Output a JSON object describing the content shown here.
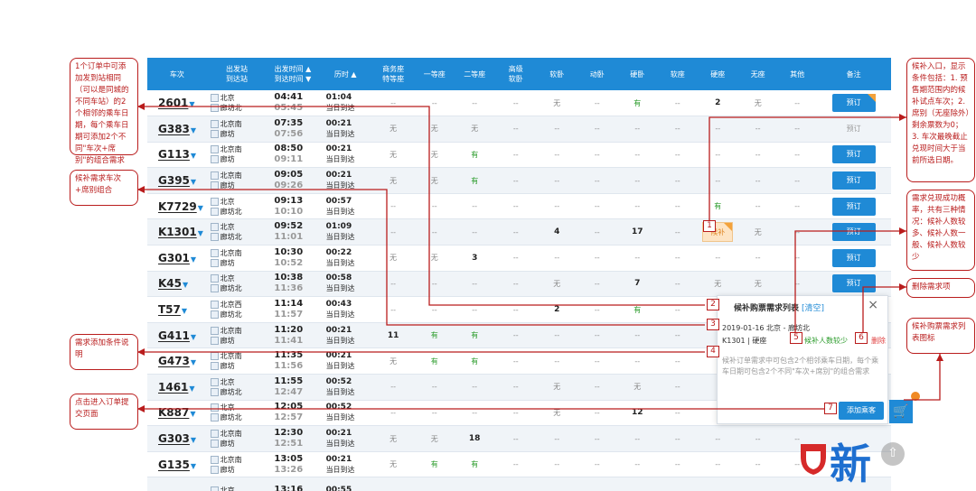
{
  "table": {
    "headers": {
      "train_no": "车次",
      "stations_dep": "出发站",
      "stations_arr": "到达站",
      "time_dep": "出发时间",
      "time_arr": "到达时间",
      "duration": "历时",
      "business_line1": "商务座",
      "business_line2": "特等座",
      "first": "一等座",
      "second": "二等座",
      "premium_line1": "高级",
      "premium_line2": "软卧",
      "soft_sleeper": "软卧",
      "moving_sleeper": "动卧",
      "hard_sleeper": "硬卧",
      "soft_seat": "软座",
      "hard_seat": "硬座",
      "no_seat": "无座",
      "other": "其他",
      "remark": "备注"
    },
    "rows": [
      {
        "train": "2601",
        "from": "北京",
        "to": "廊坊北",
        "dep": "04:41",
        "arr": "05:45",
        "dur": "01:04",
        "arrive": "当日到达",
        "seats": [
          "--",
          "--",
          "--",
          "--",
          "无",
          "--",
          "有",
          "--",
          "2",
          "无",
          "--"
        ],
        "action": "预订",
        "action_state": "enabled",
        "badge": true
      },
      {
        "train": "G383",
        "from": "北京南",
        "to": "廊坊",
        "dep": "07:35",
        "arr": "07:56",
        "dur": "00:21",
        "arrive": "当日到达",
        "seats": [
          "无",
          "无",
          "无",
          "--",
          "--",
          "--",
          "--",
          "--",
          "--",
          "--",
          "--"
        ],
        "action": "预订",
        "action_state": "disabled",
        "badge": false
      },
      {
        "train": "G113",
        "from": "北京南",
        "to": "廊坊",
        "dep": "08:50",
        "arr": "09:11",
        "dur": "00:21",
        "arrive": "当日到达",
        "seats": [
          "无",
          "无",
          "有",
          "--",
          "--",
          "--",
          "--",
          "--",
          "--",
          "--",
          "--"
        ],
        "action": "预订",
        "action_state": "enabled",
        "badge": false
      },
      {
        "train": "G395",
        "from": "北京南",
        "to": "廊坊",
        "dep": "09:05",
        "arr": "09:26",
        "dur": "00:21",
        "arrive": "当日到达",
        "seats": [
          "无",
          "无",
          "有",
          "--",
          "--",
          "--",
          "--",
          "--",
          "--",
          "--",
          "--"
        ],
        "action": "预订",
        "action_state": "enabled",
        "badge": false
      },
      {
        "train": "K7729",
        "from": "北京",
        "to": "廊坊北",
        "dep": "09:13",
        "arr": "10:10",
        "dur": "00:57",
        "arrive": "当日到达",
        "seats": [
          "--",
          "--",
          "--",
          "--",
          "--",
          "--",
          "--",
          "--",
          "有",
          "--",
          "--"
        ],
        "action": "预订",
        "action_state": "enabled",
        "badge": false
      },
      {
        "train": "K1301",
        "from": "北京",
        "to": "廊坊北",
        "dep": "09:52",
        "arr": "11:01",
        "dur": "01:09",
        "arrive": "当日到达",
        "seats": [
          "--",
          "--",
          "--",
          "--",
          "4",
          "--",
          "17",
          "--",
          "候补",
          "无",
          "--"
        ],
        "action": "预订",
        "action_state": "enabled",
        "badge": false
      },
      {
        "train": "G301",
        "from": "北京南",
        "to": "廊坊",
        "dep": "10:30",
        "arr": "10:52",
        "dur": "00:22",
        "arrive": "当日到达",
        "seats": [
          "无",
          "无",
          "3",
          "--",
          "--",
          "--",
          "--",
          "--",
          "--",
          "--",
          "--"
        ],
        "action": "预订",
        "action_state": "enabled",
        "badge": false
      },
      {
        "train": "K45",
        "from": "北京",
        "to": "廊坊北",
        "dep": "10:38",
        "arr": "11:36",
        "dur": "00:58",
        "arrive": "当日到达",
        "seats": [
          "--",
          "--",
          "--",
          "--",
          "无",
          "--",
          "7",
          "--",
          "无",
          "无",
          "--"
        ],
        "action": "预订",
        "action_state": "enabled",
        "badge": false
      },
      {
        "train": "T57",
        "from": "北京西",
        "to": "廊坊北",
        "dep": "11:14",
        "arr": "11:57",
        "dur": "00:43",
        "arrive": "当日到达",
        "seats": [
          "--",
          "--",
          "--",
          "--",
          "2",
          "--",
          "有",
          "--",
          "",
          "",
          "--"
        ],
        "action": "",
        "action_state": "hidden",
        "badge": false
      },
      {
        "train": "G411",
        "from": "北京南",
        "to": "廊坊",
        "dep": "11:20",
        "arr": "11:41",
        "dur": "00:21",
        "arrive": "当日到达",
        "seats": [
          "11",
          "有",
          "有",
          "--",
          "--",
          "--",
          "--",
          "--",
          "",
          "",
          "--"
        ],
        "action": "",
        "action_state": "hidden",
        "badge": false
      },
      {
        "train": "G473",
        "from": "北京南",
        "to": "廊坊",
        "dep": "11:35",
        "arr": "11:56",
        "dur": "00:21",
        "arrive": "当日到达",
        "seats": [
          "无",
          "有",
          "有",
          "--",
          "--",
          "--",
          "--",
          "--",
          "",
          "",
          "--"
        ],
        "action": "",
        "action_state": "hidden",
        "badge": false
      },
      {
        "train": "1461",
        "from": "北京",
        "to": "廊坊北",
        "dep": "11:55",
        "arr": "12:47",
        "dur": "00:52",
        "arrive": "当日到达",
        "seats": [
          "--",
          "--",
          "--",
          "--",
          "无",
          "--",
          "无",
          "--",
          "",
          "",
          "--"
        ],
        "action": "",
        "action_state": "hidden",
        "badge": false
      },
      {
        "train": "K887",
        "from": "北京",
        "to": "廊坊北",
        "dep": "12:05",
        "arr": "12:57",
        "dur": "00:52",
        "arrive": "当日到达",
        "seats": [
          "--",
          "--",
          "--",
          "--",
          "无",
          "--",
          "12",
          "--",
          "",
          "",
          "--"
        ],
        "action": "",
        "action_state": "hidden",
        "badge": false
      },
      {
        "train": "G303",
        "from": "北京南",
        "to": "廊坊",
        "dep": "12:30",
        "arr": "12:51",
        "dur": "00:21",
        "arrive": "当日到达",
        "seats": [
          "无",
          "无",
          "18",
          "--",
          "--",
          "--",
          "--",
          "--",
          "--",
          "--",
          "--"
        ],
        "action": "",
        "action_state": "hidden",
        "badge": false
      },
      {
        "train": "G135",
        "from": "北京南",
        "to": "廊坊",
        "dep": "13:05",
        "arr": "13:26",
        "dur": "00:21",
        "arrive": "当日到达",
        "seats": [
          "无",
          "有",
          "有",
          "--",
          "--",
          "--",
          "--",
          "--",
          "--",
          "--",
          "--"
        ],
        "action": "",
        "action_state": "hidden",
        "badge": false
      }
    ],
    "partial_row": {
      "from": "北京",
      "dep": "13:16",
      "dur": "00:55"
    }
  },
  "popup": {
    "title": "候补购票需求列表",
    "clear": "[清空]",
    "close": "×",
    "line1": "2019-01-16 北京 - 廊坊北",
    "line2": "K1301 | 硬座",
    "level": "候补人数较少",
    "delete": "删除",
    "tip": "候补订单需求中可包含2个相邻乘车日期，每个乘车日期可包含2个不同\"车次+席别\"的组合需求",
    "add_passenger": "添加乘客"
  },
  "annotations": {
    "left": [
      "1个订单中可添加发到站相同（可以是同城的不同车站）的2个相邻的乘车日期，每个乘车日期可添加2个不同\"车次+席别\"的组合需求",
      "候补需求车次+席别组合",
      "需求添加条件说明",
      "点击进入订单提交页面"
    ],
    "right": [
      "候补入口，显示条件包括：1. 预售期范围内的候补试点车次；2. 席别（无座除外）剩余票数为0；3. 车次最晚截止兑现时间大于当前所选日期。",
      "需求兑现成功概率，共有三种情况：候补人数较多、候补人数一般、候补人数较少",
      "删除需求项",
      "候补购票需求列表图标"
    ],
    "markers": [
      "1",
      "2",
      "3",
      "4",
      "5",
      "6",
      "7"
    ]
  },
  "watermark": {
    "text": "新"
  },
  "colors": {
    "header": "#1f8ad6",
    "annotation": "#b91c1c",
    "available": "#2a9b2a",
    "button": "#1f8ad6"
  }
}
